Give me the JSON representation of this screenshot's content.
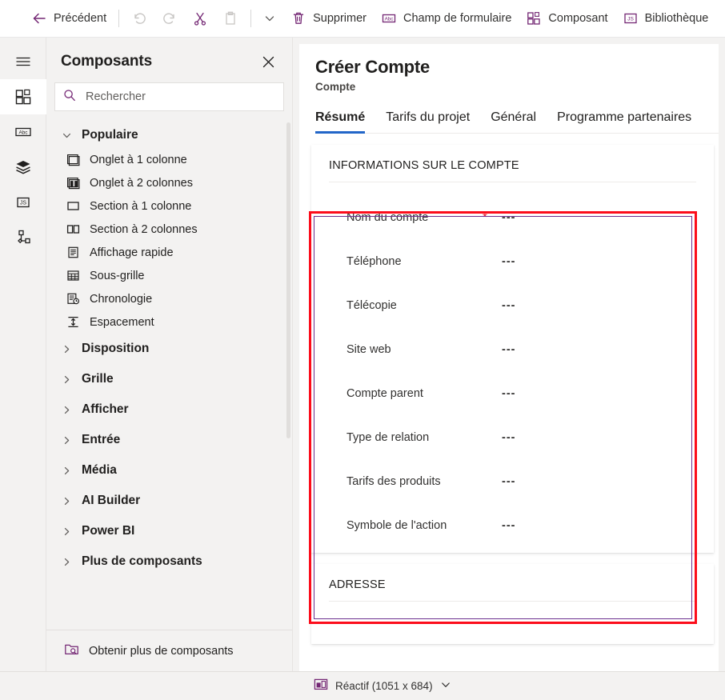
{
  "commandbar": {
    "back_label": "Précédent",
    "undo_label": "Annuler",
    "redo_label": "Rétablir",
    "cut_label": "Couper",
    "paste_label": "Coller",
    "more_label": "Plus",
    "delete_label": "Supprimer",
    "form_field_label": "Champ de formulaire",
    "component_label": "Composant",
    "library_label": "Bibliothèque"
  },
  "rail": {
    "items": [
      {
        "name": "menu",
        "label": "Menu"
      },
      {
        "name": "components",
        "label": "Composants"
      },
      {
        "name": "fields",
        "label": "Champs"
      },
      {
        "name": "layers",
        "label": "Calques"
      },
      {
        "name": "scripts",
        "label": "Scripts"
      },
      {
        "name": "tree",
        "label": "Arborescence"
      }
    ]
  },
  "panel": {
    "title": "Composants",
    "close_label": "Fermer",
    "search": {
      "placeholder": "Rechercher",
      "value": ""
    },
    "popular_group": {
      "label": "Populaire",
      "expanded": true,
      "items": [
        {
          "label": "Onglet à 1 colonne",
          "icon": "tab-one-column-icon"
        },
        {
          "label": "Onglet à 2 colonnes",
          "icon": "tab-two-columns-icon"
        },
        {
          "label": "Section à 1 colonne",
          "icon": "section-one-column-icon"
        },
        {
          "label": "Section à 2 colonnes",
          "icon": "section-two-columns-icon"
        },
        {
          "label": "Affichage rapide",
          "icon": "quick-view-icon"
        },
        {
          "label": "Sous-grille",
          "icon": "subgrid-icon"
        },
        {
          "label": "Chronologie",
          "icon": "timeline-icon"
        },
        {
          "label": "Espacement",
          "icon": "spacer-icon"
        }
      ]
    },
    "categories": [
      {
        "label": "Disposition"
      },
      {
        "label": "Grille"
      },
      {
        "label": "Afficher"
      },
      {
        "label": "Entrée"
      },
      {
        "label": "Média"
      },
      {
        "label": "AI Builder"
      },
      {
        "label": "Power BI"
      },
      {
        "label": "Plus de composants"
      }
    ],
    "footer": {
      "label": "Obtenir plus de composants"
    }
  },
  "form": {
    "title": "Créer Compte",
    "subtitle": "Compte",
    "tabs": [
      {
        "label": "Résumé",
        "active": true
      },
      {
        "label": "Tarifs du projet",
        "active": false
      },
      {
        "label": "Général",
        "active": false
      },
      {
        "label": "Programme partenaires",
        "active": false
      }
    ],
    "sections": [
      {
        "title": "INFORMATIONS SUR LE COMPTE",
        "selected": true,
        "fields": [
          {
            "label": "Nom du compte",
            "required": true,
            "value": "---"
          },
          {
            "label": "Téléphone",
            "required": false,
            "value": "---"
          },
          {
            "label": "Télécopie",
            "required": false,
            "value": "---"
          },
          {
            "label": "Site web",
            "required": false,
            "value": "---"
          },
          {
            "label": "Compte parent",
            "required": false,
            "value": "---"
          },
          {
            "label": "Type de relation",
            "required": false,
            "value": "---"
          },
          {
            "label": "Tarifs des produits",
            "required": false,
            "value": "---"
          },
          {
            "label": "Symbole de l'action",
            "required": false,
            "value": "---"
          }
        ]
      },
      {
        "title": "ADRESSE",
        "selected": false,
        "fields": []
      }
    ],
    "required_marker": "*"
  },
  "statusbar": {
    "viewport_label": "Réactif (1051 x 684)"
  },
  "colors": {
    "accent_purple": "#742774",
    "tab_underline_blue": "#2266c8",
    "selection_red": "#fc0d1b",
    "selection_purple": "#6b2f8f",
    "required_red": "#e81123",
    "panel_bg": "#f3f2f1"
  }
}
